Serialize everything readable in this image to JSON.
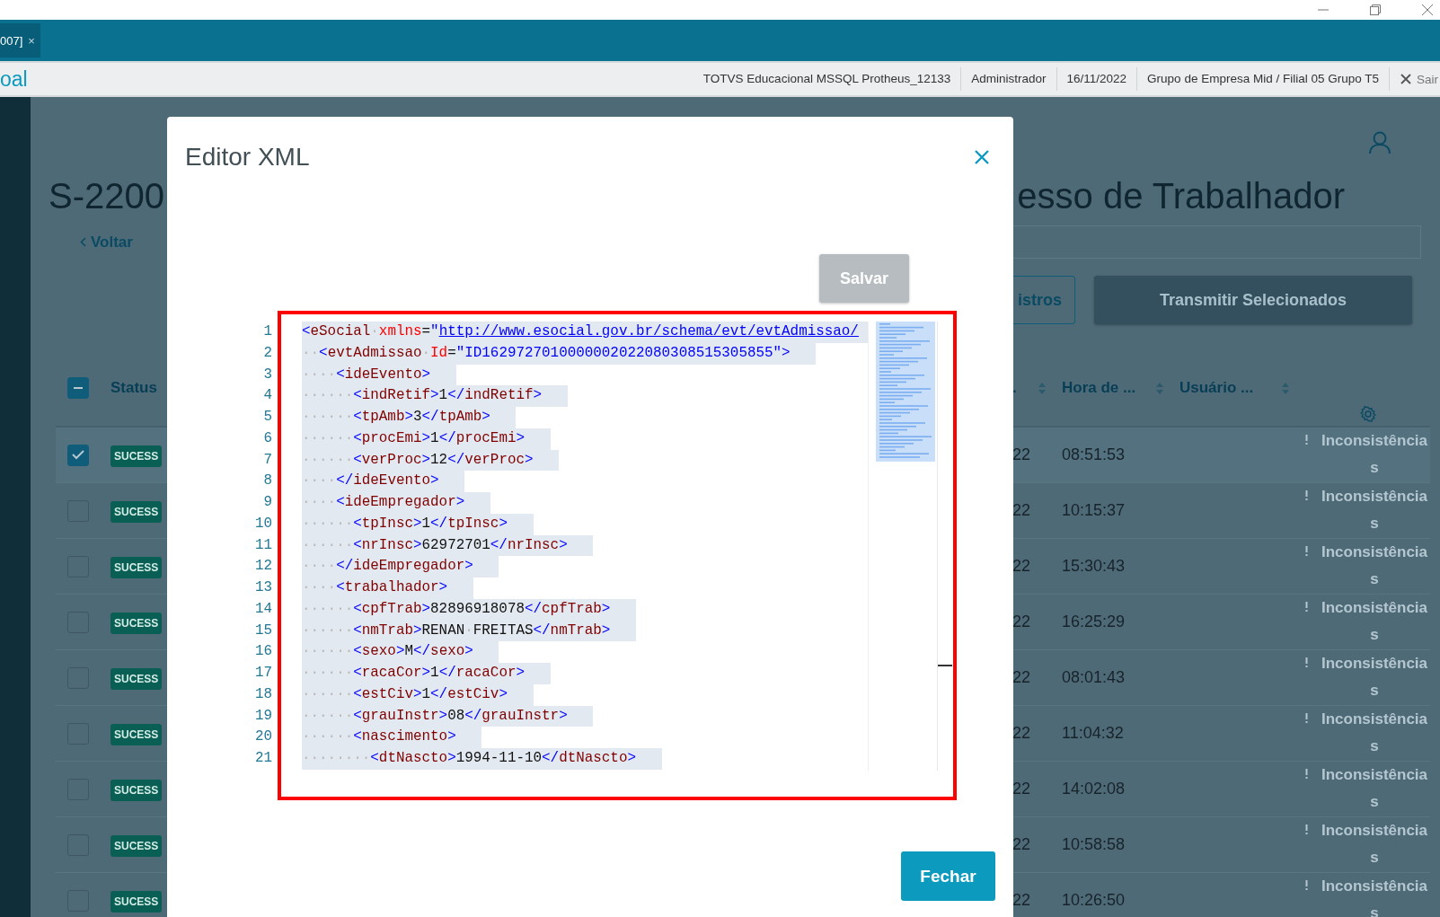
{
  "tab": {
    "label": "007]",
    "close": "×"
  },
  "app_header": {
    "title": "oal",
    "info": [
      "TOTVS Educacional MSSQL Protheus_12133",
      "Administrador",
      "16/11/2022",
      "Grupo de Empresa Mid / Filial 05 Grupo T5"
    ],
    "logout": "Sair"
  },
  "page": {
    "title_start": "S-2200",
    "title_end": "esso de Trabalhador",
    "back": "Voltar",
    "buttons": [
      {
        "label": "istros",
        "kind": "outline"
      },
      {
        "label": "Transmitir Selecionados",
        "kind": "primary"
      }
    ]
  },
  "table": {
    "header_checkbox": {
      "indeterminate": true
    },
    "columns": [
      {
        "label": "Status",
        "sortable": false
      },
      {
        "label": ".",
        "sortable": true
      },
      {
        "label": "Hora de ...",
        "sortable": true
      },
      {
        "label": "Usuário ...",
        "sortable": true
      }
    ],
    "rows": [
      {
        "selected": true,
        "status": "SUCESS",
        "date": "22",
        "time": "08:51:53",
        "warning": "Inconsistências"
      },
      {
        "selected": false,
        "status": "SUCESS",
        "date": "22",
        "time": "10:15:37",
        "warning": "Inconsistências"
      },
      {
        "selected": false,
        "status": "SUCESS",
        "date": "22",
        "time": "15:30:43",
        "warning": "Inconsistências"
      },
      {
        "selected": false,
        "status": "SUCESS",
        "date": "22",
        "time": "16:25:29",
        "warning": "Inconsistências"
      },
      {
        "selected": false,
        "status": "SUCESS",
        "date": "22",
        "time": "08:01:43",
        "warning": "Inconsistências"
      },
      {
        "selected": false,
        "status": "SUCESS",
        "date": "22",
        "time": "11:04:32",
        "warning": "Inconsistências"
      },
      {
        "selected": false,
        "status": "SUCESS",
        "date": "22",
        "time": "14:02:08",
        "warning": "Inconsistências"
      },
      {
        "selected": false,
        "status": "SUCESS",
        "date": "22",
        "time": "10:58:58",
        "warning": "Inconsistências"
      },
      {
        "selected": false,
        "status": "SUCESS",
        "date": "22",
        "time": "10:26:50",
        "warning": "Inconsistências"
      }
    ]
  },
  "modal": {
    "title": "Editor XML",
    "save": {
      "label": "Salvar",
      "disabled": true
    },
    "close_label": "Fechar",
    "editor": {
      "lines": [
        {
          "number": "1",
          "segments": [
            {
              "kind": "p",
              "text": "<"
            },
            {
              "kind": "tag",
              "text": "eSocial"
            },
            {
              "kind": "ws",
              "text": "·"
            },
            {
              "kind": "attr",
              "text": "xmlns"
            },
            {
              "kind": "eq",
              "text": "="
            },
            {
              "kind": "val",
              "text": "\""
            },
            {
              "kind": "link",
              "text": "http://www.esocial.gov.br/schema/evt/evtAdmissao/"
            }
          ]
        },
        {
          "number": "2",
          "segments": [
            {
              "kind": "ws",
              "text": "··"
            },
            {
              "kind": "p",
              "text": "<"
            },
            {
              "kind": "tag",
              "text": "evtAdmissao"
            },
            {
              "kind": "ws",
              "text": "·"
            },
            {
              "kind": "attr",
              "text": "Id"
            },
            {
              "kind": "eq",
              "text": "="
            },
            {
              "kind": "val",
              "text": "\"ID1629727010000002022080308515305855\""
            },
            {
              "kind": "p",
              "text": ">"
            }
          ]
        },
        {
          "number": "3",
          "segments": [
            {
              "kind": "ws",
              "text": "····"
            },
            {
              "kind": "p",
              "text": "<"
            },
            {
              "kind": "tag",
              "text": "ideEvento"
            },
            {
              "kind": "p",
              "text": ">"
            }
          ]
        },
        {
          "number": "4",
          "segments": [
            {
              "kind": "ws",
              "text": "······"
            },
            {
              "kind": "p",
              "text": "<"
            },
            {
              "kind": "tag",
              "text": "indRetif"
            },
            {
              "kind": "p",
              "text": ">"
            },
            {
              "kind": "text",
              "text": "1"
            },
            {
              "kind": "p",
              "text": "</"
            },
            {
              "kind": "tag",
              "text": "indRetif"
            },
            {
              "kind": "p",
              "text": ">"
            }
          ]
        },
        {
          "number": "5",
          "segments": [
            {
              "kind": "ws",
              "text": "······"
            },
            {
              "kind": "p",
              "text": "<"
            },
            {
              "kind": "tag",
              "text": "tpAmb"
            },
            {
              "kind": "p",
              "text": ">"
            },
            {
              "kind": "text",
              "text": "3"
            },
            {
              "kind": "p",
              "text": "</"
            },
            {
              "kind": "tag",
              "text": "tpAmb"
            },
            {
              "kind": "p",
              "text": ">"
            }
          ]
        },
        {
          "number": "6",
          "segments": [
            {
              "kind": "ws",
              "text": "······"
            },
            {
              "kind": "p",
              "text": "<"
            },
            {
              "kind": "tag",
              "text": "procEmi"
            },
            {
              "kind": "p",
              "text": ">"
            },
            {
              "kind": "text",
              "text": "1"
            },
            {
              "kind": "p",
              "text": "</"
            },
            {
              "kind": "tag",
              "text": "procEmi"
            },
            {
              "kind": "p",
              "text": ">"
            }
          ]
        },
        {
          "number": "7",
          "segments": [
            {
              "kind": "ws",
              "text": "······"
            },
            {
              "kind": "p",
              "text": "<"
            },
            {
              "kind": "tag",
              "text": "verProc"
            },
            {
              "kind": "p",
              "text": ">"
            },
            {
              "kind": "text",
              "text": "12"
            },
            {
              "kind": "p",
              "text": "</"
            },
            {
              "kind": "tag",
              "text": "verProc"
            },
            {
              "kind": "p",
              "text": ">"
            }
          ]
        },
        {
          "number": "8",
          "segments": [
            {
              "kind": "ws",
              "text": "····"
            },
            {
              "kind": "p",
              "text": "</"
            },
            {
              "kind": "tag",
              "text": "ideEvento"
            },
            {
              "kind": "p",
              "text": ">"
            }
          ]
        },
        {
          "number": "9",
          "segments": [
            {
              "kind": "ws",
              "text": "····"
            },
            {
              "kind": "p",
              "text": "<"
            },
            {
              "kind": "tag",
              "text": "ideEmpregador"
            },
            {
              "kind": "p",
              "text": ">"
            }
          ]
        },
        {
          "number": "10",
          "segments": [
            {
              "kind": "ws",
              "text": "······"
            },
            {
              "kind": "p",
              "text": "<"
            },
            {
              "kind": "tag",
              "text": "tpInsc"
            },
            {
              "kind": "p",
              "text": ">"
            },
            {
              "kind": "text",
              "text": "1"
            },
            {
              "kind": "p",
              "text": "</"
            },
            {
              "kind": "tag",
              "text": "tpInsc"
            },
            {
              "kind": "p",
              "text": ">"
            }
          ]
        },
        {
          "number": "11",
          "segments": [
            {
              "kind": "ws",
              "text": "······"
            },
            {
              "kind": "p",
              "text": "<"
            },
            {
              "kind": "tag",
              "text": "nrInsc"
            },
            {
              "kind": "p",
              "text": ">"
            },
            {
              "kind": "text",
              "text": "62972701"
            },
            {
              "kind": "p",
              "text": "</"
            },
            {
              "kind": "tag",
              "text": "nrInsc"
            },
            {
              "kind": "p",
              "text": ">"
            }
          ]
        },
        {
          "number": "12",
          "segments": [
            {
              "kind": "ws",
              "text": "····"
            },
            {
              "kind": "p",
              "text": "</"
            },
            {
              "kind": "tag",
              "text": "ideEmpregador"
            },
            {
              "kind": "p",
              "text": ">"
            }
          ]
        },
        {
          "number": "13",
          "segments": [
            {
              "kind": "ws",
              "text": "····"
            },
            {
              "kind": "p",
              "text": "<"
            },
            {
              "kind": "tag",
              "text": "trabalhador"
            },
            {
              "kind": "p",
              "text": ">"
            }
          ]
        },
        {
          "number": "14",
          "segments": [
            {
              "kind": "ws",
              "text": "······"
            },
            {
              "kind": "p",
              "text": "<"
            },
            {
              "kind": "tag",
              "text": "cpfTrab"
            },
            {
              "kind": "p",
              "text": ">"
            },
            {
              "kind": "text",
              "text": "82896918078"
            },
            {
              "kind": "p",
              "text": "</"
            },
            {
              "kind": "tag",
              "text": "cpfTrab"
            },
            {
              "kind": "p",
              "text": ">"
            }
          ]
        },
        {
          "number": "15",
          "segments": [
            {
              "kind": "ws",
              "text": "······"
            },
            {
              "kind": "p",
              "text": "<"
            },
            {
              "kind": "tag",
              "text": "nmTrab"
            },
            {
              "kind": "p",
              "text": ">"
            },
            {
              "kind": "text",
              "text": "RENAN"
            },
            {
              "kind": "ws",
              "text": "·"
            },
            {
              "kind": "text",
              "text": "FREITAS"
            },
            {
              "kind": "p",
              "text": "</"
            },
            {
              "kind": "tag",
              "text": "nmTrab"
            },
            {
              "kind": "p",
              "text": ">"
            }
          ]
        },
        {
          "number": "16",
          "segments": [
            {
              "kind": "ws",
              "text": "······"
            },
            {
              "kind": "p",
              "text": "<"
            },
            {
              "kind": "tag",
              "text": "sexo"
            },
            {
              "kind": "p",
              "text": ">"
            },
            {
              "kind": "text",
              "text": "M"
            },
            {
              "kind": "p",
              "text": "</"
            },
            {
              "kind": "tag",
              "text": "sexo"
            },
            {
              "kind": "p",
              "text": ">"
            }
          ]
        },
        {
          "number": "17",
          "segments": [
            {
              "kind": "ws",
              "text": "······"
            },
            {
              "kind": "p",
              "text": "<"
            },
            {
              "kind": "tag",
              "text": "racaCor"
            },
            {
              "kind": "p",
              "text": ">"
            },
            {
              "kind": "text",
              "text": "1"
            },
            {
              "kind": "p",
              "text": "</"
            },
            {
              "kind": "tag",
              "text": "racaCor"
            },
            {
              "kind": "p",
              "text": ">"
            }
          ]
        },
        {
          "number": "18",
          "segments": [
            {
              "kind": "ws",
              "text": "······"
            },
            {
              "kind": "p",
              "text": "<"
            },
            {
              "kind": "tag",
              "text": "estCiv"
            },
            {
              "kind": "p",
              "text": ">"
            },
            {
              "kind": "text",
              "text": "1"
            },
            {
              "kind": "p",
              "text": "</"
            },
            {
              "kind": "tag",
              "text": "estCiv"
            },
            {
              "kind": "p",
              "text": ">"
            }
          ]
        },
        {
          "number": "19",
          "segments": [
            {
              "kind": "ws",
              "text": "······"
            },
            {
              "kind": "p",
              "text": "<"
            },
            {
              "kind": "tag",
              "text": "grauInstr"
            },
            {
              "kind": "p",
              "text": ">"
            },
            {
              "kind": "text",
              "text": "08"
            },
            {
              "kind": "p",
              "text": "</"
            },
            {
              "kind": "tag",
              "text": "grauInstr"
            },
            {
              "kind": "p",
              "text": ">"
            }
          ]
        },
        {
          "number": "20",
          "segments": [
            {
              "kind": "ws",
              "text": "······"
            },
            {
              "kind": "p",
              "text": "<"
            },
            {
              "kind": "tag",
              "text": "nascimento"
            },
            {
              "kind": "p",
              "text": ">"
            }
          ]
        },
        {
          "number": "21",
          "segments": [
            {
              "kind": "ws",
              "text": "········"
            },
            {
              "kind": "p",
              "text": "<"
            },
            {
              "kind": "tag",
              "text": "dtNascto"
            },
            {
              "kind": "p",
              "text": ">"
            },
            {
              "kind": "text",
              "text": "1994-11-10"
            },
            {
              "kind": "p",
              "text": "</"
            },
            {
              "kind": "tag",
              "text": "dtNascto"
            },
            {
              "kind": "p",
              "text": ">"
            }
          ]
        }
      ]
    }
  }
}
